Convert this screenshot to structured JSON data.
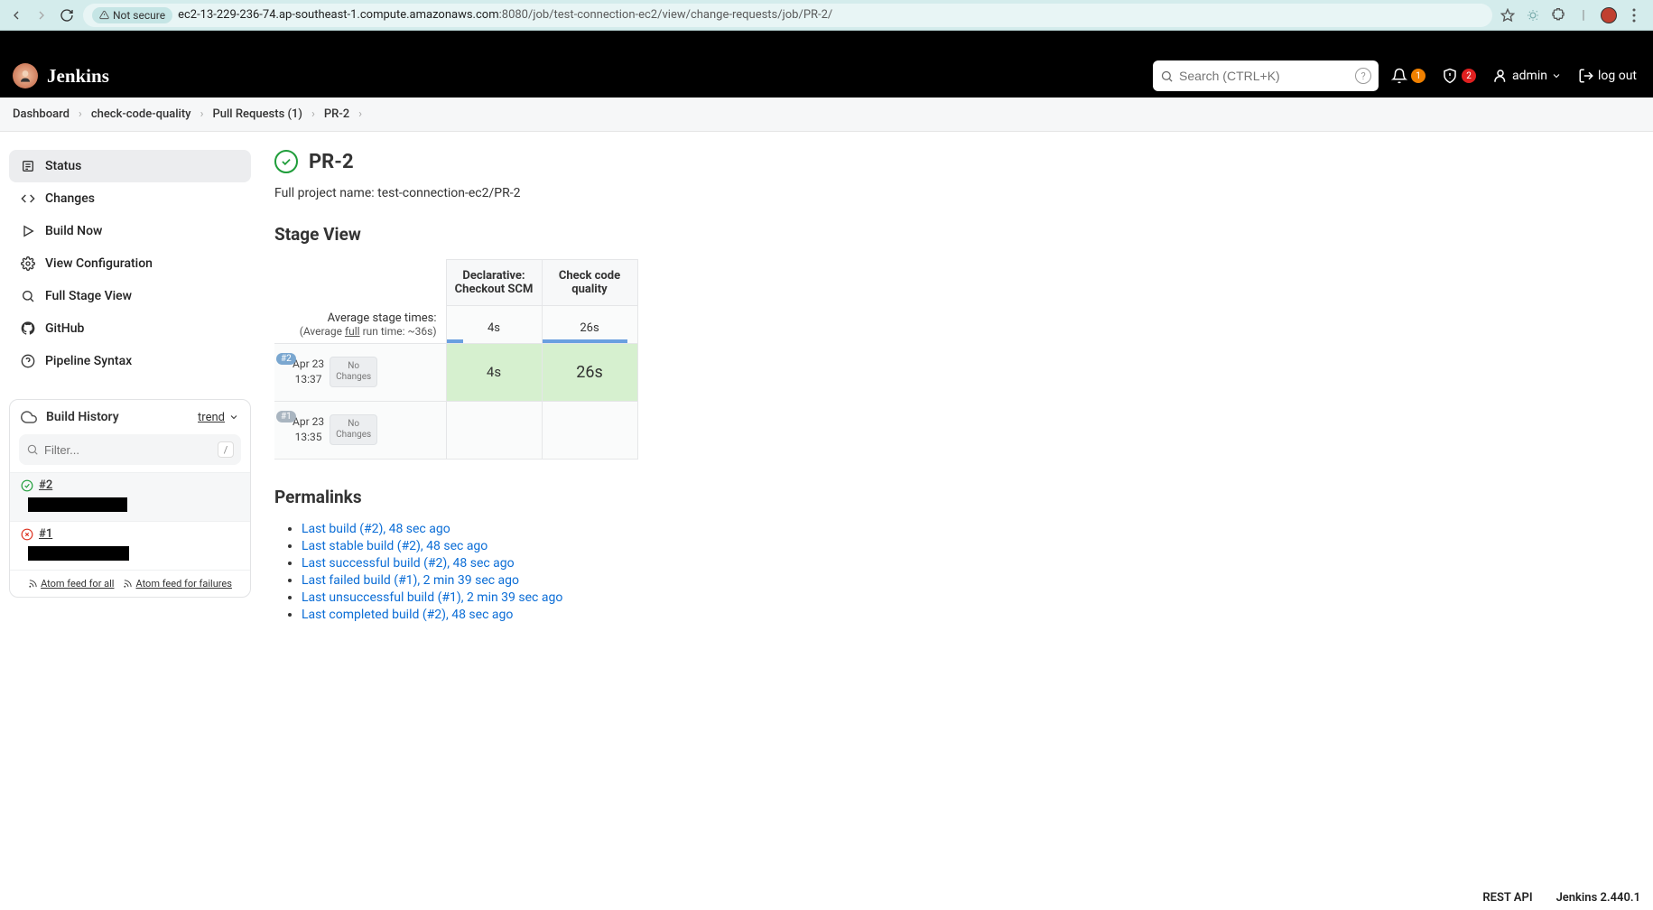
{
  "browser": {
    "not_secure": "Not secure",
    "url_prefix": "ec2-13-229-236-74.ap-southeast-1.compute.amazonaws.com",
    "url_port_path": ":8080/job/test-connection-ec2/view/change-requests/job/PR-2/"
  },
  "header": {
    "brand": "Jenkins",
    "search_placeholder": "Search (CTRL+K)",
    "notif_count": "1",
    "alert_count": "2",
    "user": "admin",
    "logout": "log out"
  },
  "breadcrumbs": {
    "items": [
      "Dashboard",
      "check-code-quality",
      "Pull Requests (1)",
      "PR-2"
    ]
  },
  "sidenav": {
    "status": "Status",
    "changes": "Changes",
    "build_now": "Build Now",
    "view_config": "View Configuration",
    "full_stage": "Full Stage View",
    "github": "GitHub",
    "pipeline_syntax": "Pipeline Syntax"
  },
  "build_history": {
    "title": "Build History",
    "trend": "trend",
    "filter_placeholder": "Filter...",
    "slash_hint": "/",
    "rows": {
      "r0": {
        "name": "#2"
      },
      "r1": {
        "name": "#1"
      }
    },
    "atom_all": "Atom feed for all",
    "atom_fail": "Atom feed for failures"
  },
  "page": {
    "title": "PR-2",
    "full_name_label": "Full project name: ",
    "full_name_value": "test-connection-ec2/PR-2",
    "stage_view_heading": "Stage View",
    "permalinks_heading": "Permalinks"
  },
  "stage": {
    "col1": "Declarative: Checkout SCM",
    "col2": "Check code quality",
    "avg_label": "Average stage times:",
    "avg_sub_pre": "(Average ",
    "avg_sub_full": "full",
    "avg_sub_post": " run time: ~36s)",
    "avg_c1": "4s",
    "avg_c2": "26s",
    "pbar_c1_width": "18%",
    "pbar_c2_width": "90%",
    "runs": {
      "b2": {
        "pill": "#2",
        "date": "Apr 23",
        "time": "13:37",
        "nc1": "No",
        "nc2": "Changes",
        "c1": "4s",
        "c2": "26s"
      },
      "b1": {
        "pill": "#1",
        "date": "Apr 23",
        "time": "13:35",
        "nc1": "No",
        "nc2": "Changes"
      }
    }
  },
  "permalinks": {
    "items": [
      "Last build (#2), 48 sec ago",
      "Last stable build (#2), 48 sec ago",
      "Last successful build (#2), 48 sec ago",
      "Last failed build (#1), 2 min 39 sec ago",
      "Last unsuccessful build (#1), 2 min 39 sec ago",
      "Last completed build (#2), 48 sec ago"
    ]
  },
  "footer": {
    "rest": "REST API",
    "version": "Jenkins 2.440.1"
  }
}
